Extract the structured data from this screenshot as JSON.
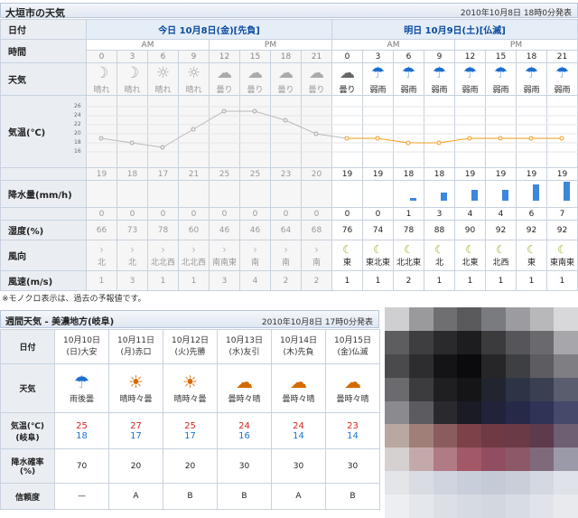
{
  "hourly": {
    "title": "大垣市の天気",
    "updated": "2010年10月8日 18時0分発表",
    "labels": {
      "date": "日付",
      "time": "時間",
      "weather": "天気",
      "temp": "気温(℃)",
      "precip": "降水量(mm/h)",
      "humidity": "湿度(%)",
      "wind_dir": "風向",
      "wind_speed": "風速(m/s)"
    },
    "today_header": "今日 10月8日(金)[先負]",
    "tomorrow_header": "明日 10月9日(土)[仏滅]",
    "am": "AM",
    "pm": "PM",
    "hours": [
      "0",
      "3",
      "6",
      "9",
      "12",
      "15",
      "18",
      "21",
      "0",
      "3",
      "6",
      "9",
      "12",
      "15",
      "18",
      "21"
    ],
    "weather": [
      {
        "icon": "moon-icon",
        "text": "晴れ"
      },
      {
        "icon": "moon-icon",
        "text": "晴れ"
      },
      {
        "icon": "sun-icon",
        "text": "晴れ"
      },
      {
        "icon": "sun-icon",
        "text": "晴れ"
      },
      {
        "icon": "cloud-icon",
        "text": "曇り"
      },
      {
        "icon": "cloud-icon",
        "text": "曇り"
      },
      {
        "icon": "cloud-icon",
        "text": "曇り"
      },
      {
        "icon": "cloud-icon",
        "text": "曇り"
      },
      {
        "icon": "cloud-icon",
        "text": "曇り"
      },
      {
        "icon": "umbrella-icon",
        "text": "弱雨"
      },
      {
        "icon": "umbrella-icon",
        "text": "弱雨"
      },
      {
        "icon": "umbrella-icon",
        "text": "弱雨"
      },
      {
        "icon": "umbrella-icon",
        "text": "弱雨"
      },
      {
        "icon": "umbrella-icon",
        "text": "弱雨"
      },
      {
        "icon": "umbrella-icon",
        "text": "弱雨"
      },
      {
        "icon": "umbrella-icon",
        "text": "弱雨"
      }
    ],
    "temp_ticks": [
      "26",
      "24",
      "22",
      "20",
      "18",
      "16"
    ],
    "temps": [
      "19",
      "18",
      "17",
      "21",
      "25",
      "25",
      "23",
      "20",
      "19",
      "19",
      "18",
      "18",
      "19",
      "19",
      "19",
      "19"
    ],
    "precip": [
      "0",
      "0",
      "0",
      "0",
      "0",
      "0",
      "0",
      "0",
      "0",
      "0",
      "1",
      "3",
      "4",
      "4",
      "6",
      "7"
    ],
    "humidity": [
      "66",
      "73",
      "78",
      "60",
      "46",
      "46",
      "64",
      "68",
      "76",
      "74",
      "78",
      "88",
      "90",
      "92",
      "92",
      "92"
    ],
    "wind_dir": [
      "北",
      "北",
      "北北西",
      "北北西",
      "南南東",
      "南",
      "南",
      "南",
      "東",
      "東北東",
      "北北東",
      "北",
      "北東",
      "北西",
      "東",
      "東南東"
    ],
    "wind_speed": [
      "1",
      "3",
      "1",
      "1",
      "3",
      "4",
      "2",
      "2",
      "1",
      "1",
      "2",
      "1",
      "1",
      "1",
      "1",
      "1"
    ],
    "past_count": 8,
    "note": "※モノクロ表示は、過去の予報値です。",
    "colors": {
      "past_bg": "#f6f6f6",
      "temp_line": "#f39a1e",
      "precip_bar": "#3d86dd",
      "header_text": "#0b4aa1"
    }
  },
  "weekly": {
    "title": "週間天気 - 美濃地方(岐阜)",
    "updated": "2010年10月8日 17時0分発表",
    "labels": {
      "date": "日付",
      "weather": "天気",
      "temp": "気温(℃)",
      "temp_sub": "(岐阜)",
      "rain": "降水確率",
      "rain_sub": "(%)",
      "reliability": "信頼度"
    },
    "days": [
      {
        "date": "10月10日",
        "dow": "(日)大安",
        "weather": "雨後曇",
        "icon": "umbrella-cloud-icon",
        "hi": "25",
        "lo": "18",
        "rain": "70",
        "rel": "—"
      },
      {
        "date": "10月11日",
        "dow": "(月)赤口",
        "weather": "晴時々曇",
        "icon": "sun-cloud-icon",
        "hi": "27",
        "lo": "17",
        "rain": "20",
        "rel": "A"
      },
      {
        "date": "10月12日",
        "dow": "(火)先勝",
        "weather": "晴時々曇",
        "icon": "sun-cloud-icon",
        "hi": "25",
        "lo": "17",
        "rain": "20",
        "rel": "B"
      },
      {
        "date": "10月13日",
        "dow": "(水)友引",
        "weather": "曇時々晴",
        "icon": "cloud-sun-icon",
        "hi": "24",
        "lo": "16",
        "rain": "30",
        "rel": "B"
      },
      {
        "date": "10月14日",
        "dow": "(木)先負",
        "weather": "曇時々晴",
        "icon": "cloud-sun-icon",
        "hi": "24",
        "lo": "14",
        "rain": "30",
        "rel": "A"
      },
      {
        "date": "10月15日",
        "dow": "(金)仏滅",
        "weather": "曇時々晴",
        "icon": "cloud-sun-icon",
        "hi": "23",
        "lo": "14",
        "rain": "30",
        "rel": "B"
      }
    ],
    "colors": {
      "hi": "#d6231e",
      "lo": "#1c75c8",
      "sun": "#d46a00"
    }
  },
  "chart_data": [
    {
      "type": "line",
      "x": [
        "0",
        "3",
        "6",
        "9",
        "12",
        "15",
        "18",
        "21",
        "0",
        "3",
        "6",
        "9",
        "12",
        "15",
        "18",
        "21"
      ],
      "series": [
        {
          "values": [
            19,
            18,
            17,
            21,
            25,
            25,
            23,
            20,
            19,
            19,
            18,
            18,
            19,
            19,
            19,
            19
          ]
        }
      ],
      "ylabel": "気温(℃)",
      "ylim": [
        16,
        26
      ],
      "yticks": [
        26,
        24,
        22,
        20,
        18,
        16
      ],
      "grid": true
    },
    {
      "type": "bar",
      "categories": [
        "0",
        "3",
        "6",
        "9",
        "12",
        "15",
        "18",
        "21",
        "0",
        "3",
        "6",
        "9",
        "12",
        "15",
        "18",
        "21"
      ],
      "values": [
        0,
        0,
        0,
        0,
        0,
        0,
        0,
        0,
        0,
        0,
        1,
        3,
        4,
        4,
        6,
        7
      ],
      "ylabel": "降水量(mm/h)"
    }
  ]
}
